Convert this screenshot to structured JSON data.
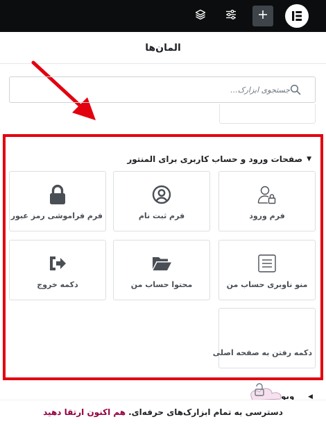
{
  "topbar": {
    "icons": [
      "layers-icon",
      "sliders-icon",
      "plus-icon",
      "elementor-logo"
    ]
  },
  "header": {
    "title": "المان‌ها"
  },
  "search": {
    "placeholder": "جستجوی ابزارک..."
  },
  "section": {
    "title": "صفحات ورود و حساب کاربری برای المنتور",
    "widgets": [
      {
        "label": "فرم ورود",
        "icon": "user-lock-icon"
      },
      {
        "label": "فرم ثبت نام",
        "icon": "user-circle-icon"
      },
      {
        "label": "فرم فراموشی رمز عبور",
        "icon": "lock-icon"
      },
      {
        "label": "منو ناوبری حساب من",
        "icon": "menu-list-icon"
      },
      {
        "label": "محتوا حساب من",
        "icon": "folder-open-icon"
      },
      {
        "label": "دکمه خروج",
        "icon": "sign-out-icon"
      },
      {
        "label": "دکمه رفتن به صفحه اصلی",
        "icon": ""
      }
    ]
  },
  "below": {
    "label": "ویو"
  },
  "promo": {
    "text": "دسترسی به تمام ابزارک‌های حرفه‌ای.",
    "link": "هم اکنون ارتقا دهید"
  },
  "colors": {
    "highlight": "#e3000f",
    "promo_link": "#93003f",
    "topbar": "#0c0d0e"
  }
}
